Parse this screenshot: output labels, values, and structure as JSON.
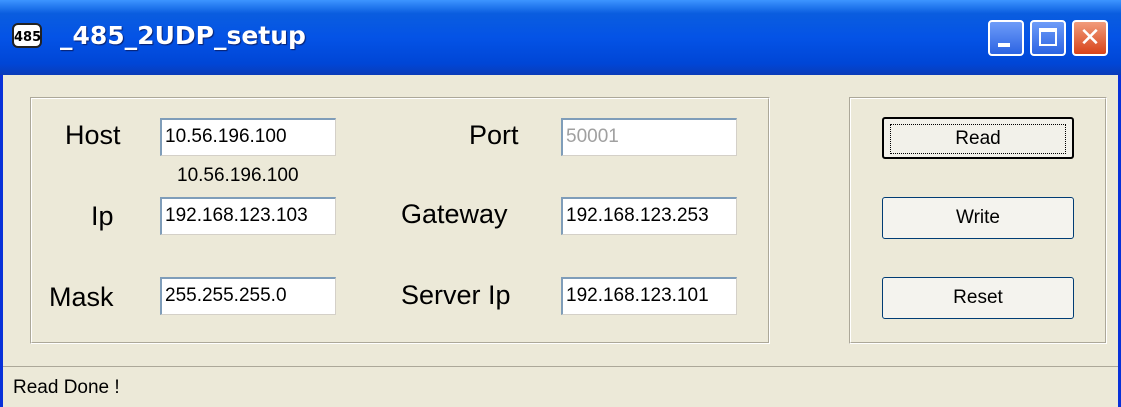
{
  "window": {
    "title": "_485_2UDP_setup",
    "icon_text": "485",
    "icon_name": "app-icon-485",
    "buttons": {
      "minimize": "minimize-icon",
      "maximize": "maximize-icon",
      "close": "close-icon",
      "close_glyph": "✕"
    }
  },
  "form": {
    "host": {
      "label": "Host",
      "value": "10.56.196.100",
      "resolved": "10.56.196.100"
    },
    "port": {
      "label": "Port",
      "value": "50001",
      "disabled": true
    },
    "ip": {
      "label": "Ip",
      "value": "192.168.123.103"
    },
    "gateway": {
      "label": "Gateway",
      "value": "192.168.123.253"
    },
    "mask": {
      "label": "Mask",
      "value": "255.255.255.0"
    },
    "server_ip": {
      "label": "Server Ip",
      "value": "192.168.123.101"
    }
  },
  "actions": {
    "read_label": "Read",
    "write_label": "Write",
    "reset_label": "Reset"
  },
  "status": {
    "text": "Read Done !"
  },
  "colors": {
    "titlebar": "#0453e6",
    "face": "#ece9d8",
    "close_button": "#d8431a"
  }
}
